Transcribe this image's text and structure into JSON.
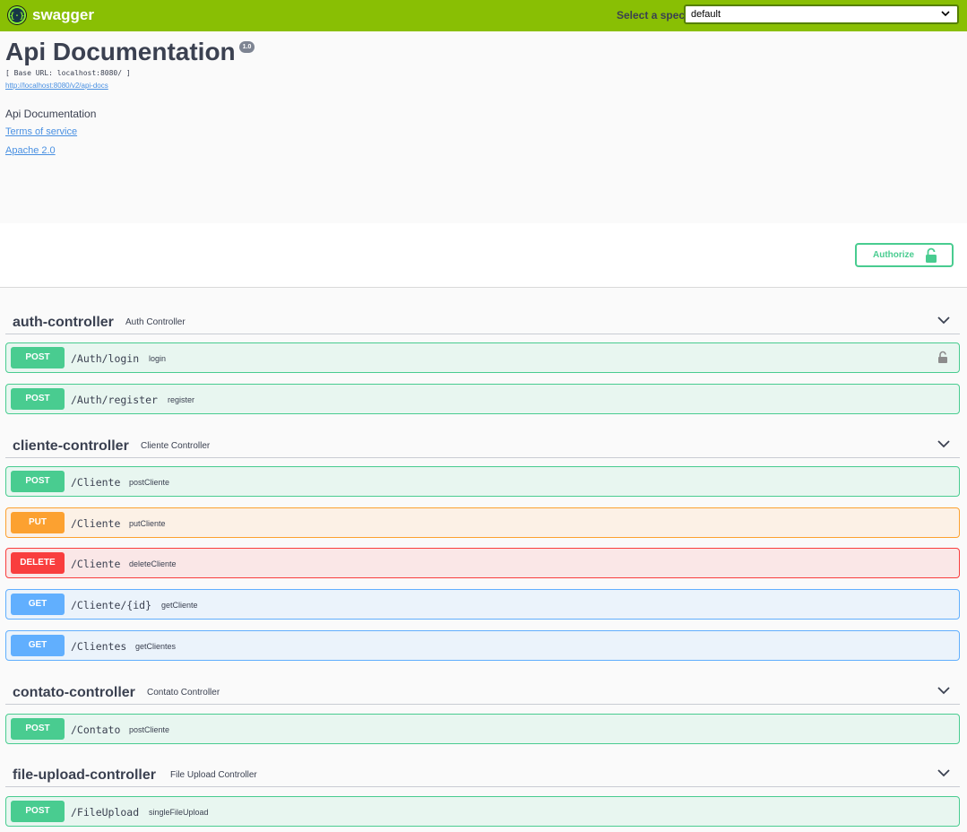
{
  "topbar": {
    "brand": "swagger",
    "spec_label": "Select a spec",
    "spec_value": "default",
    "bg_color": "#89bf04"
  },
  "info": {
    "title": "Api Documentation",
    "version": "1.0",
    "base_url": "[ Base URL: localhost:8080/ ]",
    "docs_link": "http://localhost:8080/v2/api-docs",
    "description": "Api Documentation",
    "terms": "Terms of service",
    "license": "Apache 2.0"
  },
  "authorize": {
    "label": "Authorize",
    "icon": "unlock-icon"
  },
  "tags": [
    {
      "name": "auth-controller",
      "description": "Auth Controller",
      "operations": [
        {
          "method": "POST",
          "path": "/Auth/login",
          "summary": "login",
          "locked": true
        },
        {
          "method": "POST",
          "path": "/Auth/register",
          "summary": "register"
        }
      ]
    },
    {
      "name": "cliente-controller",
      "description": "Cliente Controller",
      "operations": [
        {
          "method": "POST",
          "path": "/Cliente",
          "summary": "postCliente"
        },
        {
          "method": "PUT",
          "path": "/Cliente",
          "summary": "putCliente"
        },
        {
          "method": "DELETE",
          "path": "/Cliente",
          "summary": "deleteCliente"
        },
        {
          "method": "GET",
          "path": "/Cliente/{id}",
          "summary": "getCliente"
        },
        {
          "method": "GET",
          "path": "/Clientes",
          "summary": "getClientes"
        }
      ]
    },
    {
      "name": "contato-controller",
      "description": "Contato Controller",
      "operations": [
        {
          "method": "POST",
          "path": "/Contato",
          "summary": "postCliente"
        }
      ]
    },
    {
      "name": "file-upload-controller",
      "description": "File Upload Controller",
      "operations": [
        {
          "method": "POST",
          "path": "/FileUpload",
          "summary": "singleFileUpload"
        }
      ]
    }
  ],
  "method_colors": {
    "POST": "#49cc90",
    "PUT": "#fca130",
    "DELETE": "#f93e3e",
    "GET": "#61affe"
  }
}
